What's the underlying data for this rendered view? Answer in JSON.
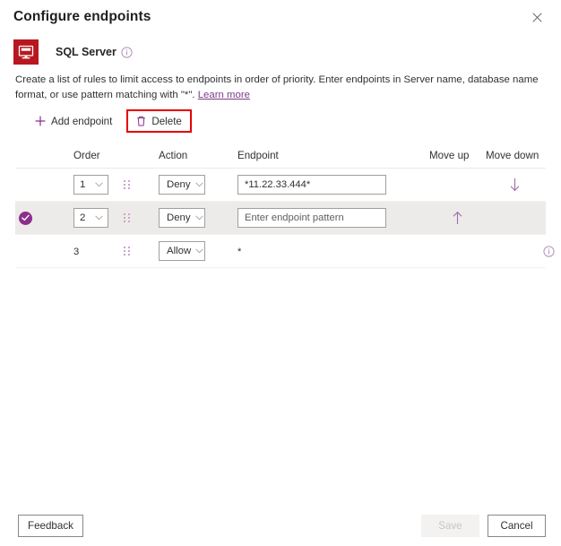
{
  "header": {
    "title": "Configure endpoints",
    "close_icon": "close-icon"
  },
  "product": {
    "name": "SQL Server",
    "icon": "sql-server-icon",
    "info_icon": "info-icon"
  },
  "description": {
    "text": "Create a list of rules to limit access to endpoints in order of priority. Enter endpoints in Server name, database name format, or use pattern matching with \"*\". ",
    "link_label": "Learn more"
  },
  "command_bar": {
    "add_label": "Add endpoint",
    "add_icon": "plus-icon",
    "delete_label": "Delete",
    "delete_icon": "trash-icon",
    "highlight_color": "#e60000"
  },
  "table": {
    "columns": {
      "order": "Order",
      "action": "Action",
      "endpoint": "Endpoint",
      "move_up": "Move up",
      "move_down": "Move down"
    },
    "rows": [
      {
        "selected": false,
        "order": "1",
        "order_is_select": true,
        "action": "Deny",
        "action_is_select": true,
        "endpoint_value": "*11.22.33.444*",
        "endpoint_placeholder": "",
        "endpoint_is_input": true,
        "move_up": "",
        "move_down": "down-arrow-icon",
        "info": ""
      },
      {
        "selected": true,
        "order": "2",
        "order_is_select": true,
        "action": "Deny",
        "action_is_select": true,
        "endpoint_value": "",
        "endpoint_placeholder": "Enter endpoint pattern",
        "endpoint_is_input": true,
        "move_up": "up-arrow-icon",
        "move_down": "",
        "info": ""
      },
      {
        "selected": false,
        "order": "3",
        "order_is_select": false,
        "action": "Allow",
        "action_is_select": true,
        "endpoint_value": "*",
        "endpoint_placeholder": "",
        "endpoint_is_input": false,
        "move_up": "",
        "move_down": "",
        "info": "info-icon"
      }
    ]
  },
  "footer": {
    "feedback_label": "Feedback",
    "save_label": "Save",
    "save_disabled": true,
    "cancel_label": "Cancel"
  },
  "colors": {
    "accent_purple": "#8c2f8c",
    "product_red": "#b8171f",
    "highlight_red": "#e60000",
    "selected_row": "#edebe9"
  }
}
